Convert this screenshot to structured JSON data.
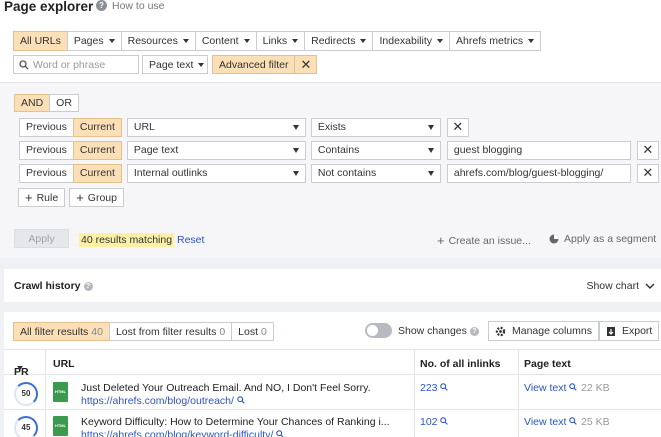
{
  "header": {
    "title": "Page explorer",
    "help_icon": "?",
    "how_to": "How to use"
  },
  "filters": [
    "All URLs",
    "Pages",
    "Resources",
    "Content",
    "Links",
    "Redirects",
    "Indexability",
    "Ahrefs metrics"
  ],
  "search": {
    "placeholder": "Word or phrase",
    "scope": "Page text",
    "advanced": "Advanced filter"
  },
  "logic": {
    "and": "AND",
    "or": "OR"
  },
  "rows": [
    {
      "prev": "Previous",
      "cur": "Current",
      "field": "URL",
      "op": "Exists",
      "value": ""
    },
    {
      "prev": "Previous",
      "cur": "Current",
      "field": "Page text",
      "op": "Contains",
      "value": "guest blogging"
    },
    {
      "prev": "Previous",
      "cur": "Current",
      "field": "Internal outlinks",
      "op": "Not contains",
      "value": "ahrefs.com/blog/guest-blogging/"
    }
  ],
  "actions": {
    "rule": "Rule",
    "group": "Group",
    "apply": "Apply",
    "matching": "40 results matching",
    "reset": "Reset",
    "create_issue": "Create an issue...",
    "apply_segment": "Apply as a segment"
  },
  "crawl": {
    "label": "Crawl history",
    "show_chart": "Show chart"
  },
  "results": {
    "tabs": [
      {
        "label": "All filter results",
        "count": "40"
      },
      {
        "label": "Lost from filter results",
        "count": "0"
      },
      {
        "label": "Lost",
        "count": "0"
      }
    ],
    "show_changes": "Show changes",
    "manage_columns": "Manage columns",
    "export": "Export",
    "columns": {
      "pr": "PR",
      "url": "URL",
      "inlinks": "No. of all inlinks",
      "page_text": "Page text"
    },
    "rows": [
      {
        "pr": "50",
        "file": "HTML",
        "title": "Just Deleted Your Outreach Email. And NO, I Don't Feel Sorry.",
        "url": "https://ahrefs.com/blog/outreach/",
        "inlinks": "223",
        "view": "View text",
        "size": "22 KB"
      },
      {
        "pr": "45",
        "file": "HTML",
        "title": "Keyword Difficulty: How to Determine Your Chances of Ranking i...",
        "url": "https://ahrefs.com/blog/keyword-difficulty/",
        "inlinks": "102",
        "view": "View text",
        "size": "25 KB"
      }
    ]
  },
  "colors": {
    "accent": "#fbdfb6",
    "link": "#2a55c9",
    "highlight": "#fcf0a5"
  }
}
